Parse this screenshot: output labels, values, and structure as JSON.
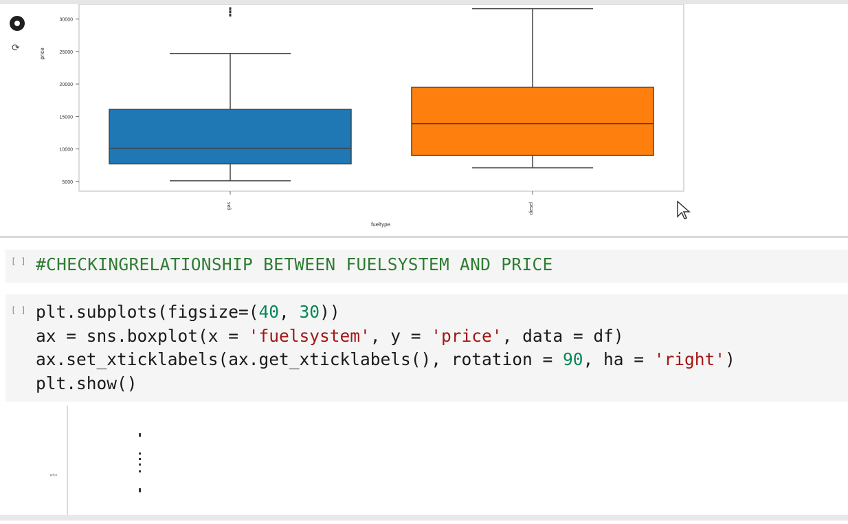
{
  "output_cell_top": {
    "run_icon": "stop-circle-icon",
    "output_icon": "output-menu-icon"
  },
  "chart_data": {
    "type": "box",
    "xlabel": "fueltype",
    "ylabel": "price",
    "categories": [
      "gas",
      "diesel"
    ],
    "y_ticks": [
      "5000",
      "10000",
      "15000",
      "20000",
      "25000",
      "30000"
    ],
    "series": [
      {
        "category": "gas",
        "color": "#1f77b4",
        "whisker_low": 5100,
        "q1": 7700,
        "median": 10100,
        "q3": 16100,
        "whisker_high": 24700,
        "outliers": [
          30500,
          31000,
          31500
        ]
      },
      {
        "category": "diesel",
        "color": "#ff7f0e",
        "whisker_low": 7100,
        "q1": 9000,
        "median": 13900,
        "q3": 19500,
        "whisker_high": 31600,
        "outliers": []
      }
    ],
    "ylim": [
      3500,
      32300
    ]
  },
  "markdown_cell": {
    "brackets": "[ ]",
    "text": "#CHECKINGRELATIONSHIP BETWEEN FUELSYSTEM AND PRICE"
  },
  "code_cell": {
    "brackets": "[ ]",
    "line1_prefix": "plt.subplots(figsize=(",
    "line1_num1": "40",
    "line1_sep": ", ",
    "line1_num2": "30",
    "line1_suffix": "))",
    "line2_a": "ax = sns.boxplot(x = ",
    "line2_str1": "'fuelsystem'",
    "line2_b": ", y = ",
    "line2_str2": "'price'",
    "line2_c": ", data = df)",
    "line3_a": "ax.set_xticklabels(ax.get_xticklabels(), rotation = ",
    "line3_num": "90",
    "line3_b": ", ha = ",
    "line3_str": "'right'",
    "line3_c": ")",
    "line4": "plt.show()"
  },
  "bottom_output": {
    "ylabel": "price"
  }
}
